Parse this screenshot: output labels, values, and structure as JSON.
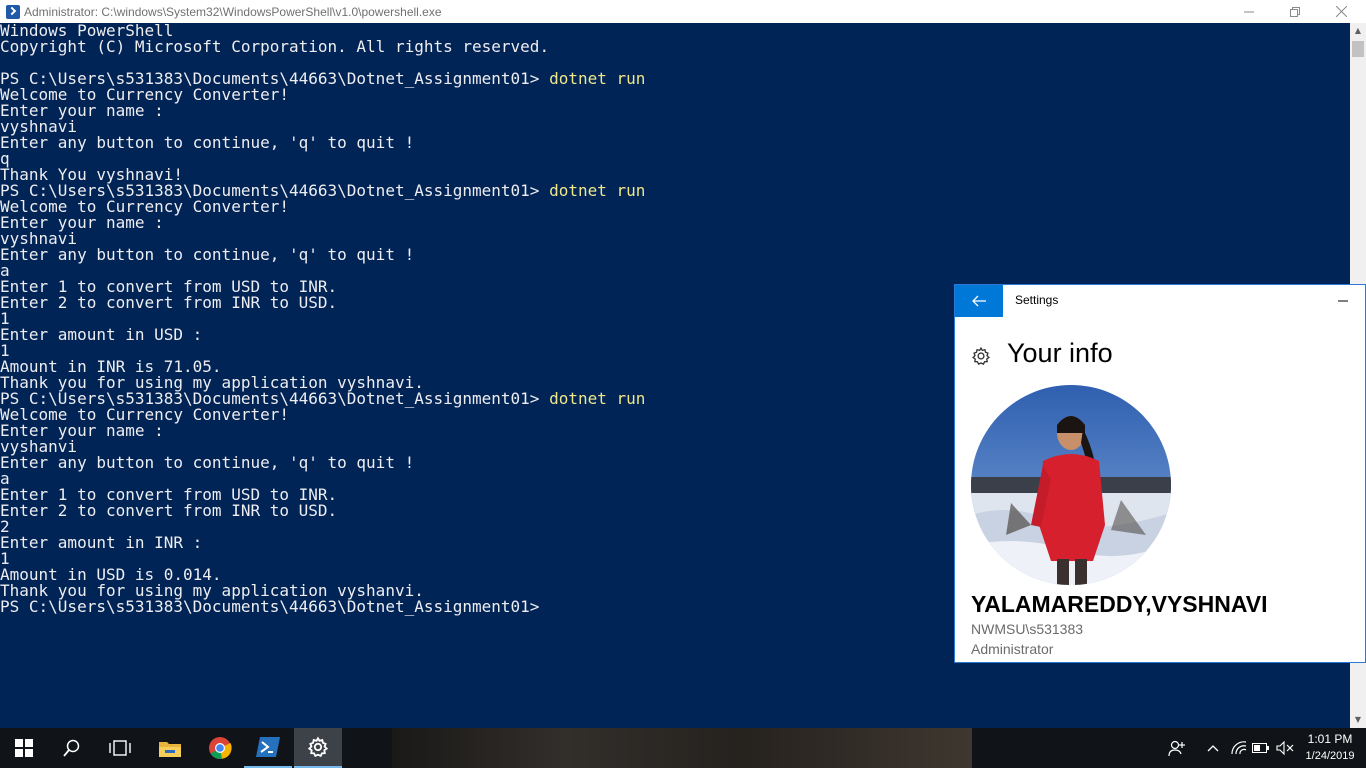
{
  "powershell": {
    "title": "Administrator: C:\\windows\\System32\\WindowsPowerShell\\v1.0\\powershell.exe",
    "lines": [
      {
        "text": "Windows PowerShell"
      },
      {
        "text": "Copyright (C) Microsoft Corporation. All rights reserved."
      },
      {
        "text": ""
      },
      {
        "text": "PS C:\\Users\\s531383\\Documents\\44663\\Dotnet_Assignment01> ",
        "cmd": "dotnet run"
      },
      {
        "text": "Welcome to Currency Converter!"
      },
      {
        "text": "Enter your name :"
      },
      {
        "text": "vyshnavi"
      },
      {
        "text": "Enter any button to continue, 'q' to quit !"
      },
      {
        "text": "q"
      },
      {
        "text": "Thank You vyshnavi!"
      },
      {
        "text": "PS C:\\Users\\s531383\\Documents\\44663\\Dotnet_Assignment01> ",
        "cmd": "dotnet run"
      },
      {
        "text": "Welcome to Currency Converter!"
      },
      {
        "text": "Enter your name :"
      },
      {
        "text": "vyshnavi"
      },
      {
        "text": "Enter any button to continue, 'q' to quit !"
      },
      {
        "text": "a"
      },
      {
        "text": "Enter 1 to convert from USD to INR."
      },
      {
        "text": "Enter 2 to convert from INR to USD."
      },
      {
        "text": "1"
      },
      {
        "text": "Enter amount in USD :"
      },
      {
        "text": "1"
      },
      {
        "text": "Amount in INR is 71.05."
      },
      {
        "text": "Thank you for using my application vyshnavi."
      },
      {
        "text": "PS C:\\Users\\s531383\\Documents\\44663\\Dotnet_Assignment01> ",
        "cmd": "dotnet run"
      },
      {
        "text": "Welcome to Currency Converter!"
      },
      {
        "text": "Enter your name :"
      },
      {
        "text": "vyshanvi"
      },
      {
        "text": "Enter any button to continue, 'q' to quit !"
      },
      {
        "text": "a"
      },
      {
        "text": "Enter 1 to convert from USD to INR."
      },
      {
        "text": "Enter 2 to convert from INR to USD."
      },
      {
        "text": "2"
      },
      {
        "text": "Enter amount in INR :"
      },
      {
        "text": "1"
      },
      {
        "text": "Amount in USD is 0.014."
      },
      {
        "text": "Thank you for using my application vyshanvi."
      },
      {
        "text": "PS C:\\Users\\s531383\\Documents\\44663\\Dotnet_Assignment01>"
      }
    ],
    "colors": {
      "background": "#012456",
      "text": "#eeedf0",
      "command": "#f0e68c"
    }
  },
  "settings": {
    "title": "Settings",
    "heading": "Your info",
    "user_name": "YALAMAREDDY,VYSHNAVI",
    "account": "NWMSU\\s531383",
    "role": "Administrator",
    "accent": "#0078d7"
  },
  "taskbar": {
    "apps": [
      "windows-start-icon",
      "search-icon",
      "task-view-icon",
      "file-explorer-icon",
      "chrome-icon",
      "powershell-icon",
      "settings-gear-icon"
    ],
    "time": "1:01 PM",
    "date": "1/24/2019"
  }
}
